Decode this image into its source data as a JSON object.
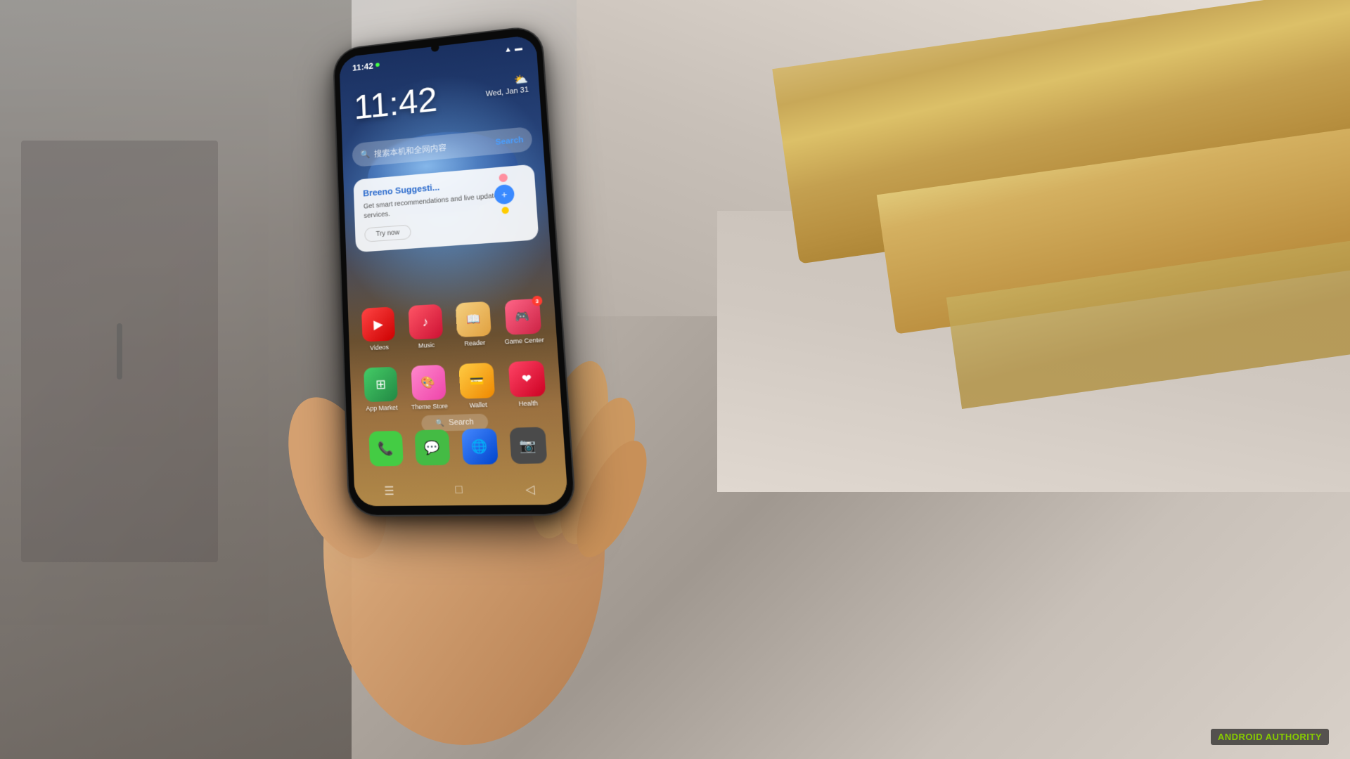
{
  "scene": {
    "background": "#b8b8b8"
  },
  "phone": {
    "status_bar": {
      "time": "11:42",
      "green_dot": true,
      "wifi_icon": "wifi",
      "battery_icon": "battery"
    },
    "clock": {
      "time": "11:42"
    },
    "date": {
      "text": "Wed, Jan 31"
    },
    "search_bar": {
      "placeholder": "搜索本机和全网内容",
      "button_label": "Search"
    },
    "breeno_card": {
      "title": "Breeno Suggesti...",
      "description": "Get smart recommendations and live updates for services.",
      "button_label": "Try now"
    },
    "apps_row1": [
      {
        "name": "Videos",
        "icon_type": "videos",
        "badge": null
      },
      {
        "name": "Music",
        "icon_type": "music",
        "badge": null
      },
      {
        "name": "Reader",
        "icon_type": "reader",
        "badge": null
      },
      {
        "name": "Game Center",
        "icon_type": "game",
        "badge": "3"
      }
    ],
    "apps_row2": [
      {
        "name": "App Market",
        "icon_type": "appmarket",
        "badge": null
      },
      {
        "name": "Theme Store",
        "icon_type": "themestore",
        "badge": null
      },
      {
        "name": "Wallet",
        "icon_type": "wallet",
        "badge": null
      },
      {
        "name": "Health",
        "icon_type": "health",
        "badge": null
      }
    ],
    "bottom_search": {
      "placeholder": "Search"
    },
    "dock": [
      {
        "name": "Phone",
        "icon_type": "phone"
      },
      {
        "name": "Messages",
        "icon_type": "msg"
      },
      {
        "name": "Browser",
        "icon_type": "browser"
      },
      {
        "name": "Camera",
        "icon_type": "camera"
      }
    ],
    "nav_bar": {
      "menu_icon": "☰",
      "home_icon": "□",
      "back_icon": "◁"
    }
  },
  "watermark": {
    "brand": "ANDROID",
    "suffix": " AUTHORITY"
  }
}
